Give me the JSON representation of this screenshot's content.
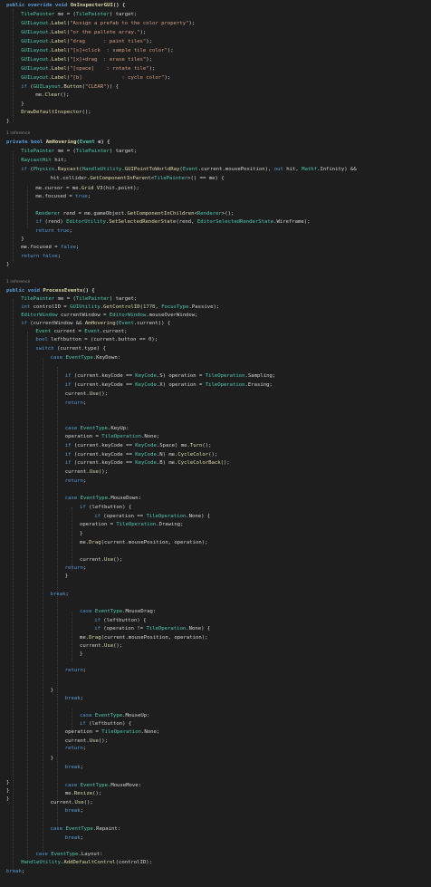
{
  "code_lines": [
    [
      [
        "kw",
        "public "
      ],
      [
        "kw",
        "override "
      ],
      [
        "kw",
        "void "
      ],
      [
        "fn",
        "OnInspectorGUI"
      ],
      [
        "pl",
        "() {"
      ]
    ],
    [
      [
        "ty",
        "TilePainter "
      ],
      [
        "pl",
        "me = ("
      ],
      [
        "ty",
        "TilePainter"
      ],
      [
        "pl",
        ") target;"
      ]
    ],
    [
      [
        "ty",
        "GUILayout"
      ],
      [
        "pl",
        "."
      ],
      [
        "fn",
        "Label"
      ],
      [
        "pl",
        "("
      ],
      [
        "st",
        "\"Assign a prefab to the color property\""
      ],
      [
        "pl",
        ");"
      ]
    ],
    [
      [
        "ty",
        "GUILayout"
      ],
      [
        "pl",
        "."
      ],
      [
        "fn",
        "Label"
      ],
      [
        "pl",
        "("
      ],
      [
        "st",
        "\"or the pallete array.\""
      ],
      [
        "pl",
        ");"
      ]
    ],
    [
      [
        "ty",
        "GUILayout"
      ],
      [
        "pl",
        "."
      ],
      [
        "fn",
        "Label"
      ],
      [
        "pl",
        "("
      ],
      [
        "st",
        "\"drag      : paint tiles\""
      ],
      [
        "pl",
        ");"
      ]
    ],
    [
      [
        "ty",
        "GUILayout"
      ],
      [
        "pl",
        "."
      ],
      [
        "fn",
        "Label"
      ],
      [
        "pl",
        "("
      ],
      [
        "st",
        "\"[s]+click  : sample tile color\""
      ],
      [
        "pl",
        ");"
      ]
    ],
    [
      [
        "ty",
        "GUILayout"
      ],
      [
        "pl",
        "."
      ],
      [
        "fn",
        "Label"
      ],
      [
        "pl",
        "("
      ],
      [
        "st",
        "\"[x]+drag  : erase tiles\""
      ],
      [
        "pl",
        ");"
      ]
    ],
    [
      [
        "ty",
        "GUILayout"
      ],
      [
        "pl",
        "."
      ],
      [
        "fn",
        "Label"
      ],
      [
        "pl",
        "("
      ],
      [
        "st",
        "\"[space]    : rotate tile\""
      ],
      [
        "pl",
        ");"
      ]
    ],
    [
      [
        "ty",
        "GUILayout"
      ],
      [
        "pl",
        "."
      ],
      [
        "fn",
        "Label"
      ],
      [
        "pl",
        "("
      ],
      [
        "st",
        "\"[b]             : cycle color\""
      ],
      [
        "pl",
        ");"
      ]
    ],
    [
      [
        "kw",
        "if "
      ],
      [
        "pl",
        "("
      ],
      [
        "ty",
        "GUILayout"
      ],
      [
        "pl",
        "."
      ],
      [
        "fn",
        "Button"
      ],
      [
        "pl",
        "("
      ],
      [
        "st",
        "\"CLEAR\""
      ],
      [
        "pl",
        ")) {"
      ]
    ],
    [
      [
        "pl",
        "me."
      ],
      [
        "fn",
        "Clear"
      ],
      [
        "pl",
        "();"
      ]
    ],
    [
      [
        "pl",
        "}"
      ]
    ],
    [
      [
        "fn",
        "DrawDefaultInspector"
      ],
      [
        "pl",
        "();"
      ]
    ],
    [
      [
        "pl",
        "}"
      ]
    ],
    [
      [
        "cl",
        "1 reference"
      ]
    ],
    [
      [
        "kw",
        "private "
      ],
      [
        "kw",
        "bool "
      ],
      [
        "fn",
        "AmHovering"
      ],
      [
        "pl",
        "("
      ],
      [
        "ty",
        "Event "
      ],
      [
        "pl",
        "e) {"
      ]
    ],
    [
      [
        "ty",
        "TilePainter "
      ],
      [
        "pl",
        "me = ("
      ],
      [
        "ty",
        "TilePainter"
      ],
      [
        "pl",
        ") target;"
      ]
    ],
    [
      [
        "ty",
        "RaycastHit "
      ],
      [
        "pl",
        "hit;"
      ]
    ],
    [
      [
        "kw",
        "if "
      ],
      [
        "pl",
        "("
      ],
      [
        "ty",
        "Physics"
      ],
      [
        "pl",
        "."
      ],
      [
        "fn",
        "Raycast"
      ],
      [
        "pl",
        "("
      ],
      [
        "ty",
        "HandleUtility"
      ],
      [
        "pl",
        "."
      ],
      [
        "fn",
        "GUIPointToWorldRay"
      ],
      [
        "pl",
        "("
      ],
      [
        "ty",
        "Event"
      ],
      [
        "pl",
        ".current.mousePosition), "
      ],
      [
        "kw",
        "out "
      ],
      [
        "pl",
        "hit, "
      ],
      [
        "ty",
        "Mathf"
      ],
      [
        "pl",
        ".Infinity) &&"
      ]
    ],
    [
      [
        "pl",
        "hit.collider."
      ],
      [
        "fn",
        "GetComponentInParent"
      ],
      [
        "pl",
        "<"
      ],
      [
        "ty",
        "TilePainter"
      ],
      [
        "pl",
        ">() == me) {"
      ]
    ],
    [
      [
        "pl",
        "me.cursor = me."
      ],
      [
        "fn",
        "Grid V3"
      ],
      [
        "pl",
        "(hit.point);"
      ]
    ],
    [
      [
        "pl",
        "me.focused = "
      ],
      [
        "kw",
        "true"
      ],
      [
        "pl",
        ";"
      ]
    ],
    [
      [
        "pl",
        ""
      ]
    ],
    [
      [
        "ty",
        "Renderer "
      ],
      [
        "pl",
        "rend = me.gameObject."
      ],
      [
        "fn",
        "GetComponentInChildren"
      ],
      [
        "pl",
        "<"
      ],
      [
        "ty",
        "Renderer"
      ],
      [
        "pl",
        ">();"
      ]
    ],
    [
      [
        "kw",
        "if "
      ],
      [
        "pl",
        "(rend) "
      ],
      [
        "ty",
        "EditorUtility"
      ],
      [
        "pl",
        "."
      ],
      [
        "fn",
        "SetSelectedRenderState"
      ],
      [
        "pl",
        "(rend, "
      ],
      [
        "ty",
        "EditorSelectedRenderState"
      ],
      [
        "pl",
        ".Wireframe);"
      ]
    ],
    [
      [
        "kw",
        "return "
      ],
      [
        "kw",
        "true"
      ],
      [
        "pl",
        ";"
      ]
    ],
    [
      [
        "pl",
        "}"
      ]
    ],
    [
      [
        "pl",
        "me.focused = "
      ],
      [
        "kw",
        "false"
      ],
      [
        "pl",
        ";"
      ]
    ],
    [
      [
        "kw",
        "return "
      ],
      [
        "kw",
        "false"
      ],
      [
        "pl",
        ";"
      ]
    ],
    [
      [
        "pl",
        "}"
      ]
    ],
    [
      [
        "cl",
        "1 reference"
      ]
    ],
    [
      [
        "kw",
        "public "
      ],
      [
        "kw",
        "void "
      ],
      [
        "fn",
        "ProcessEvents"
      ],
      [
        "pl",
        "() {"
      ]
    ],
    [
      [
        "ty",
        "TilePainter "
      ],
      [
        "pl",
        "me = ("
      ],
      [
        "ty",
        "TilePainter"
      ],
      [
        "pl",
        ") target;"
      ]
    ],
    [
      [
        "kw",
        "int "
      ],
      [
        "pl",
        "controlID = "
      ],
      [
        "ty",
        "GUIUtility"
      ],
      [
        "pl",
        "."
      ],
      [
        "fn",
        "GetControlID"
      ],
      [
        "pl",
        "("
      ],
      [
        "nu",
        "1778"
      ],
      [
        "pl",
        ", "
      ],
      [
        "ty",
        "FocusType"
      ],
      [
        "pl",
        ".Passive);"
      ]
    ],
    [
      [
        "ty",
        "EditorWindow "
      ],
      [
        "pl",
        "currentWindow = "
      ],
      [
        "ty",
        "EditorWindow"
      ],
      [
        "pl",
        ".mouseOverWindow;"
      ]
    ],
    [
      [
        "kw",
        "if "
      ],
      [
        "pl",
        "(currentWindow && "
      ],
      [
        "fn",
        "AmHovering"
      ],
      [
        "pl",
        "("
      ],
      [
        "ty",
        "Event"
      ],
      [
        "pl",
        ".current)) {"
      ]
    ],
    [
      [
        "ty",
        "Event "
      ],
      [
        "pl",
        "current = "
      ],
      [
        "ty",
        "Event"
      ],
      [
        "pl",
        ".current;"
      ]
    ],
    [
      [
        "kw",
        "bool "
      ],
      [
        "pl",
        "leftbutton = (current.button == "
      ],
      [
        "nu",
        "0"
      ],
      [
        "pl",
        ");"
      ]
    ],
    [
      [
        "kw",
        "switch "
      ],
      [
        "pl",
        "(current.type) {"
      ]
    ],
    [
      [
        "kw",
        "case "
      ],
      [
        "ty",
        "EventType"
      ],
      [
        "pl",
        ".KeyDown:"
      ]
    ],
    [
      [
        "pl",
        ""
      ]
    ],
    [
      [
        "kw",
        "if "
      ],
      [
        "pl",
        "(current.keyCode == "
      ],
      [
        "ty",
        "KeyCode"
      ],
      [
        "pl",
        ".S) operation = "
      ],
      [
        "ty",
        "TileOperation"
      ],
      [
        "pl",
        ".Sampling;"
      ]
    ],
    [
      [
        "kw",
        "if "
      ],
      [
        "pl",
        "(current.keyCode == "
      ],
      [
        "ty",
        "KeyCode"
      ],
      [
        "pl",
        ".X) operation = "
      ],
      [
        "ty",
        "TileOperation"
      ],
      [
        "pl",
        ".Erasing;"
      ]
    ],
    [
      [
        "pl",
        "current."
      ],
      [
        "fn",
        "Use"
      ],
      [
        "pl",
        "();"
      ]
    ],
    [
      [
        "kw",
        "return"
      ],
      [
        "pl",
        ";"
      ]
    ],
    [
      [
        "pl",
        ""
      ]
    ],
    [
      [
        "kw",
        "case "
      ],
      [
        "ty",
        "EventType"
      ],
      [
        "pl",
        ".KeyUp:"
      ]
    ],
    [
      [
        "pl",
        "operation = "
      ],
      [
        "ty",
        "TileOperation"
      ],
      [
        "pl",
        ".None;"
      ]
    ],
    [
      [
        "kw",
        "if "
      ],
      [
        "pl",
        "(current.keyCode == "
      ],
      [
        "ty",
        "KeyCode"
      ],
      [
        "pl",
        ".Space) me."
      ],
      [
        "fn",
        "Turn"
      ],
      [
        "pl",
        "();"
      ]
    ],
    [
      [
        "kw",
        "if "
      ],
      [
        "pl",
        "(current.keyCode == "
      ],
      [
        "ty",
        "KeyCode"
      ],
      [
        "pl",
        ".N) me."
      ],
      [
        "fn",
        "CycleColor"
      ],
      [
        "pl",
        "();"
      ]
    ],
    [
      [
        "kw",
        "if "
      ],
      [
        "pl",
        "(current.keyCode == "
      ],
      [
        "ty",
        "KeyCode"
      ],
      [
        "pl",
        ".B) me."
      ],
      [
        "fn",
        "CycleColorBack"
      ],
      [
        "pl",
        "();"
      ]
    ],
    [
      [
        "pl",
        "current."
      ],
      [
        "fn",
        "Use"
      ],
      [
        "pl",
        "();"
      ]
    ],
    [
      [
        "kw",
        "return"
      ],
      [
        "pl",
        ";"
      ]
    ],
    [
      [
        "pl",
        ""
      ]
    ],
    [
      [
        "kw",
        "case "
      ],
      [
        "ty",
        "EventType"
      ],
      [
        "pl",
        ".MouseDown:"
      ]
    ],
    [
      [
        "kw",
        "if "
      ],
      [
        "pl",
        "(leftbutton) {"
      ]
    ],
    [
      [
        "kw",
        "if "
      ],
      [
        "pl",
        "(operation == "
      ],
      [
        "ty",
        "TileOperation"
      ],
      [
        "pl",
        ".None) {"
      ]
    ],
    [
      [
        "pl",
        "operation = "
      ],
      [
        "ty",
        "TileOperation"
      ],
      [
        "pl",
        ".Drawing;"
      ]
    ],
    [
      [
        "pl",
        "}"
      ]
    ],
    [
      [
        "pl",
        "me."
      ],
      [
        "fn",
        "Drag"
      ],
      [
        "pl",
        "(current.mousePosition, operation);"
      ]
    ],
    [
      [
        "pl",
        ""
      ]
    ],
    [
      [
        "pl",
        "current."
      ],
      [
        "fn",
        "Use"
      ],
      [
        "pl",
        "();"
      ]
    ],
    [
      [
        "kw",
        "return"
      ],
      [
        "pl",
        ";"
      ]
    ],
    [
      [
        "pl",
        "}"
      ]
    ],
    [
      [
        "kw",
        "break"
      ],
      [
        "pl",
        ";"
      ]
    ],
    [
      [
        "pl",
        ""
      ]
    ],
    [
      [
        "kw",
        "case "
      ],
      [
        "ty",
        "EventType"
      ],
      [
        "pl",
        ".MouseDrag:"
      ]
    ],
    [
      [
        "kw",
        "if "
      ],
      [
        "pl",
        "(leftbutton) {"
      ]
    ],
    [
      [
        "kw",
        "if "
      ],
      [
        "pl",
        "(operation != "
      ],
      [
        "ty",
        "TileOperation"
      ],
      [
        "pl",
        ".None) {"
      ]
    ],
    [
      [
        "pl",
        "me."
      ],
      [
        "fn",
        "Drag"
      ],
      [
        "pl",
        "(current.mousePosition, operation);"
      ]
    ],
    [
      [
        "pl",
        "current."
      ],
      [
        "fn",
        "Use"
      ],
      [
        "pl",
        "();"
      ]
    ],
    [
      [
        "pl",
        "}"
      ]
    ],
    [
      [
        "pl",
        ""
      ]
    ],
    [
      [
        "kw",
        "return"
      ],
      [
        "pl",
        ";"
      ]
    ],
    [
      [
        "pl",
        "}"
      ]
    ],
    [
      [
        "kw",
        "break"
      ],
      [
        "pl",
        ";"
      ]
    ],
    [
      [
        "pl",
        ""
      ]
    ],
    [
      [
        "kw",
        "case "
      ],
      [
        "ty",
        "EventType"
      ],
      [
        "pl",
        ".MouseUp:"
      ]
    ],
    [
      [
        "kw",
        "if "
      ],
      [
        "pl",
        "(leftbutton) {"
      ]
    ],
    [
      [
        "pl",
        "operation = "
      ],
      [
        "ty",
        "TileOperation"
      ],
      [
        "pl",
        ".None;"
      ]
    ],
    [
      [
        "pl",
        "current."
      ],
      [
        "fn",
        "Use"
      ],
      [
        "pl",
        "();"
      ]
    ],
    [
      [
        "kw",
        "return"
      ],
      [
        "pl",
        ";"
      ]
    ],
    [
      [
        "pl",
        "}"
      ]
    ],
    [
      [
        "kw",
        "break"
      ],
      [
        "pl",
        ";"
      ]
    ],
    [
      [
        "pl",
        ""
      ]
    ],
    [
      [
        "kw",
        "case "
      ],
      [
        "ty",
        "EventType"
      ],
      [
        "pl",
        ".MouseMove:"
      ]
    ],
    [
      [
        "pl",
        "me."
      ],
      [
        "fn",
        "Resize"
      ],
      [
        "pl",
        "();"
      ]
    ],
    [
      [
        "pl",
        "current."
      ],
      [
        "fn",
        "Use"
      ],
      [
        "pl",
        "();"
      ]
    ],
    [
      [
        "kw",
        "break"
      ],
      [
        "pl",
        ";"
      ]
    ],
    [
      [
        "pl",
        ""
      ]
    ],
    [
      [
        "kw",
        "case "
      ],
      [
        "ty",
        "EventType"
      ],
      [
        "pl",
        ".Repaint:"
      ]
    ],
    [
      [
        "kw",
        "break"
      ],
      [
        "pl",
        ";"
      ]
    ],
    [
      [
        "pl",
        ""
      ]
    ],
    [
      [
        "kw",
        "case "
      ],
      [
        "ty",
        "EventType"
      ],
      [
        "pl",
        ".Layout:"
      ]
    ],
    [
      [
        "ty",
        "HandleUtility"
      ],
      [
        "pl",
        "."
      ],
      [
        "fn",
        "AddDefaultControl"
      ],
      [
        "pl",
        "(controlID);"
      ]
    ],
    [
      [
        "kw",
        "break"
      ],
      [
        "pl",
        ";"
      ]
    ],
    [
      [
        "pl",
        "}"
      ]
    ],
    [
      [
        "pl",
        "}"
      ]
    ],
    [
      [
        "pl",
        "}"
      ]
    ]
  ]
}
